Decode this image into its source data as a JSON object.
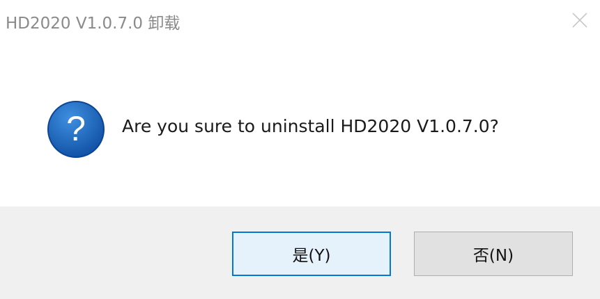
{
  "window": {
    "title": "HD2020 V1.0.7.0 卸载"
  },
  "dialog": {
    "message": "Are you sure to uninstall HD2020 V1.0.7.0?",
    "icon": "question-icon",
    "icon_glyph": "?"
  },
  "buttons": {
    "yes_label": "是(Y)",
    "no_label": "否(N)"
  },
  "colors": {
    "icon_blue": "#1a64b8",
    "default_button_border": "#0078d7",
    "default_button_fill": "#e5f1fb",
    "footer_bg": "#f0f0f0"
  }
}
